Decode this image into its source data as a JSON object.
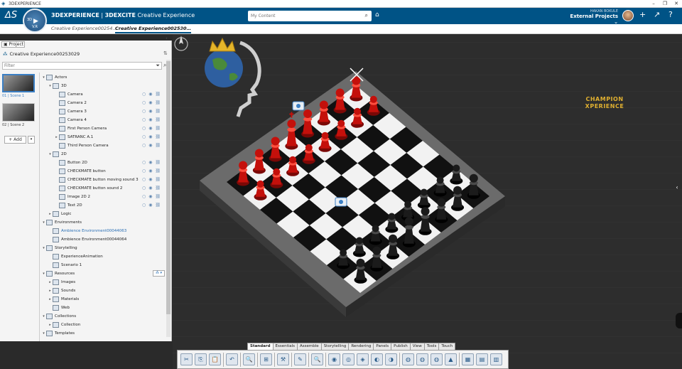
{
  "window": {
    "title": "3DEXPERIENCE",
    "controls": [
      "–",
      "❐",
      "✕"
    ]
  },
  "topbar": {
    "brand_bold": "3DEXPERIENCE",
    "brand_sep": " | ",
    "brand_app": "3DEXCITE",
    "brand_suffix": " Creative Experience",
    "compass_version": "V.R",
    "compass_play": "▶",
    "compass_num": "3D",
    "search_placeholder": "My Content",
    "user_name": "HAKAN BOKULE",
    "project": "External Projects ⌄",
    "colors": {
      "bar": "#005386",
      "accent": "#3b7fc4",
      "chess_red": "#c4100b"
    }
  },
  "tabs": [
    {
      "label": "Creative Experience00254…",
      "active": false
    },
    {
      "label": "Creative Experience002530…",
      "active": true
    }
  ],
  "tab_add": "+",
  "panel": {
    "tab_label": "Project",
    "project_title": "Creative Experience00253029",
    "filter_placeholder": "Filter",
    "scenes": [
      {
        "label": "01 | Scene 1",
        "selected": true
      },
      {
        "label": "02 | Scene 2",
        "selected": false
      }
    ],
    "add_label": "+ Add",
    "resource_filter": "⁂ ▾",
    "tree": [
      {
        "label": "Actors",
        "level": 0,
        "expanded": true,
        "icon": "actors-icon"
      },
      {
        "label": "3D",
        "level": 1,
        "expanded": true,
        "icon": "3d-icon"
      },
      {
        "label": "Camera",
        "level": 2,
        "icon": "camera-icon",
        "flags": true
      },
      {
        "label": "Camera 2",
        "level": 2,
        "icon": "camera-icon",
        "flags": true
      },
      {
        "label": "Camera 3",
        "level": 2,
        "icon": "camera-icon",
        "flags": true
      },
      {
        "label": "Camera 4",
        "level": 2,
        "icon": "camera-icon",
        "flags": true
      },
      {
        "label": "First Person Camera",
        "level": 2,
        "icon": "camera-icon",
        "flags": true
      },
      {
        "label": "SATRANC A.1",
        "level": 2,
        "expandable": true,
        "icon": "model-icon",
        "flags": true
      },
      {
        "label": "Third Person Camera",
        "level": 2,
        "icon": "camera-icon",
        "flags": true
      },
      {
        "label": "2D",
        "level": 1,
        "expanded": true,
        "icon": "2d-icon"
      },
      {
        "label": "Button 2D",
        "level": 2,
        "icon": "button-icon",
        "flags": true
      },
      {
        "label": "CHECKMATE button",
        "level": 2,
        "icon": "button-icon",
        "flags": true
      },
      {
        "label": "CHECKMATE button moving sound 3",
        "level": 2,
        "icon": "button-icon",
        "flags": true
      },
      {
        "label": "CHECKMATE button sound 2",
        "level": 2,
        "icon": "button-icon",
        "flags": true
      },
      {
        "label": "Image 2D 2",
        "level": 2,
        "icon": "image-icon",
        "flags": true
      },
      {
        "label": "Text 2D",
        "level": 2,
        "icon": "text-icon",
        "flags": true
      },
      {
        "label": "Logic",
        "level": 1,
        "expandable": true,
        "icon": "logic-icon"
      },
      {
        "label": "Environments",
        "level": 0,
        "expanded": true,
        "icon": "environment-icon"
      },
      {
        "label": "Ambience Environment00044063",
        "level": 1,
        "icon": "ambience-icon",
        "blue": true
      },
      {
        "label": "Ambience Environment00044064",
        "level": 1,
        "icon": "ambience-icon"
      },
      {
        "label": "Storytelling",
        "level": 0,
        "expanded": true,
        "icon": "storytelling-icon"
      },
      {
        "label": "ExperienceAnimation",
        "level": 1,
        "icon": "animation-icon"
      },
      {
        "label": "Scenario 1",
        "level": 1,
        "icon": "scenario-icon"
      },
      {
        "label": "Resources",
        "level": 0,
        "expanded": true,
        "icon": "resources-icon"
      },
      {
        "label": "Images",
        "level": 1,
        "expandable": true,
        "icon": "images-icon"
      },
      {
        "label": "Sounds",
        "level": 1,
        "expandable": true,
        "icon": "sounds-icon"
      },
      {
        "label": "Materials",
        "level": 1,
        "expandable": true,
        "icon": "materials-icon"
      },
      {
        "label": "Web",
        "level": 1,
        "icon": "web-icon"
      },
      {
        "label": "Collections",
        "level": 0,
        "expanded": true,
        "icon": "collections-icon"
      },
      {
        "label": "Collection",
        "level": 1,
        "expandable": true,
        "icon": "collection-icon"
      },
      {
        "label": "Templates",
        "level": 0,
        "expanded": true,
        "icon": "templates-icon"
      }
    ]
  },
  "overlay": {
    "logo_text_1": "CHAMPION",
    "logo_text_2": "XPERIENCE"
  },
  "workshop_tabs": [
    "Standard",
    "Essentials",
    "Assemble",
    "Storytelling",
    "Rendering",
    "Panels",
    "Publish",
    "View",
    "Tools",
    "Touch"
  ],
  "active_workshop_tab": "Standard",
  "tools": [
    {
      "name": "cut-icon",
      "glyph": "✂"
    },
    {
      "name": "copy-icon",
      "glyph": "⎘"
    },
    {
      "name": "paste-icon",
      "glyph": "📋"
    },
    {
      "name": "sep"
    },
    {
      "name": "undo-icon",
      "glyph": "↶"
    },
    {
      "name": "sep"
    },
    {
      "name": "search-tool-icon",
      "glyph": "🔍"
    },
    {
      "name": "sep"
    },
    {
      "name": "tree-icon",
      "glyph": "⊞"
    },
    {
      "name": "sep"
    },
    {
      "name": "measure-icon",
      "glyph": "⚒"
    },
    {
      "name": "sep"
    },
    {
      "name": "annotate-icon",
      "glyph": "✎"
    },
    {
      "name": "sep"
    },
    {
      "name": "zoom-icon",
      "glyph": "🔍"
    },
    {
      "name": "sep"
    },
    {
      "name": "render-1-icon",
      "glyph": "◉"
    },
    {
      "name": "render-2-icon",
      "glyph": "◎"
    },
    {
      "name": "render-3-icon",
      "glyph": "◈"
    },
    {
      "name": "render-4-icon",
      "glyph": "◐"
    },
    {
      "name": "render-5-icon",
      "glyph": "◑"
    },
    {
      "name": "sep"
    },
    {
      "name": "globe-1-icon",
      "glyph": "◍"
    },
    {
      "name": "globe-2-icon",
      "glyph": "◍"
    },
    {
      "name": "globe-3-icon",
      "glyph": "◍"
    },
    {
      "name": "terrain-icon",
      "glyph": "▲"
    },
    {
      "name": "sep"
    },
    {
      "name": "layout-1-icon",
      "glyph": "▦"
    },
    {
      "name": "layout-2-icon",
      "glyph": "▤"
    },
    {
      "name": "layout-3-icon",
      "glyph": "▥"
    }
  ]
}
